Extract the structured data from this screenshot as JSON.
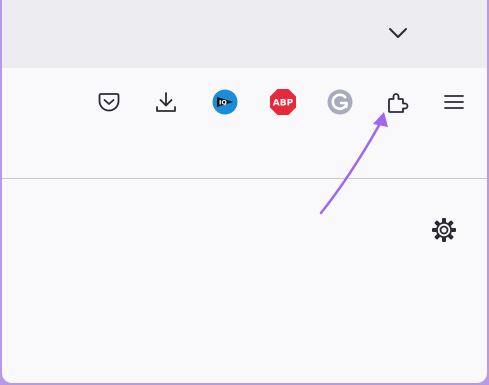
{
  "browser": {
    "tab_bar": {
      "list_all_tabs_icon": "chevron-down-icon"
    },
    "toolbar": {
      "buttons": [
        {
          "name": "pocket",
          "icon": "pocket-icon"
        },
        {
          "name": "downloads",
          "icon": "download-icon"
        },
        {
          "name": "iq-extension",
          "icon": "iq-extension-icon",
          "badge_text": "IQ",
          "color": "#1a8cd8"
        },
        {
          "name": "adblock-plus",
          "icon": "abp-icon",
          "badge_text": "ABP",
          "color": "#e8283b"
        },
        {
          "name": "grammarly",
          "icon": "grammarly-icon",
          "color": "#a7abbd"
        },
        {
          "name": "extensions",
          "icon": "puzzle-piece-icon"
        },
        {
          "name": "menu",
          "icon": "hamburger-menu-icon"
        }
      ]
    },
    "page": {
      "settings_icon": "gear-icon"
    }
  },
  "annotation": {
    "arrow_color": "#a066f0",
    "points_to": "extensions"
  },
  "colors": {
    "frame_border": "#b79ae6",
    "tab_bar": "#ededf1",
    "toolbar": "#f9f9fb",
    "icon": "#2b2a33"
  }
}
